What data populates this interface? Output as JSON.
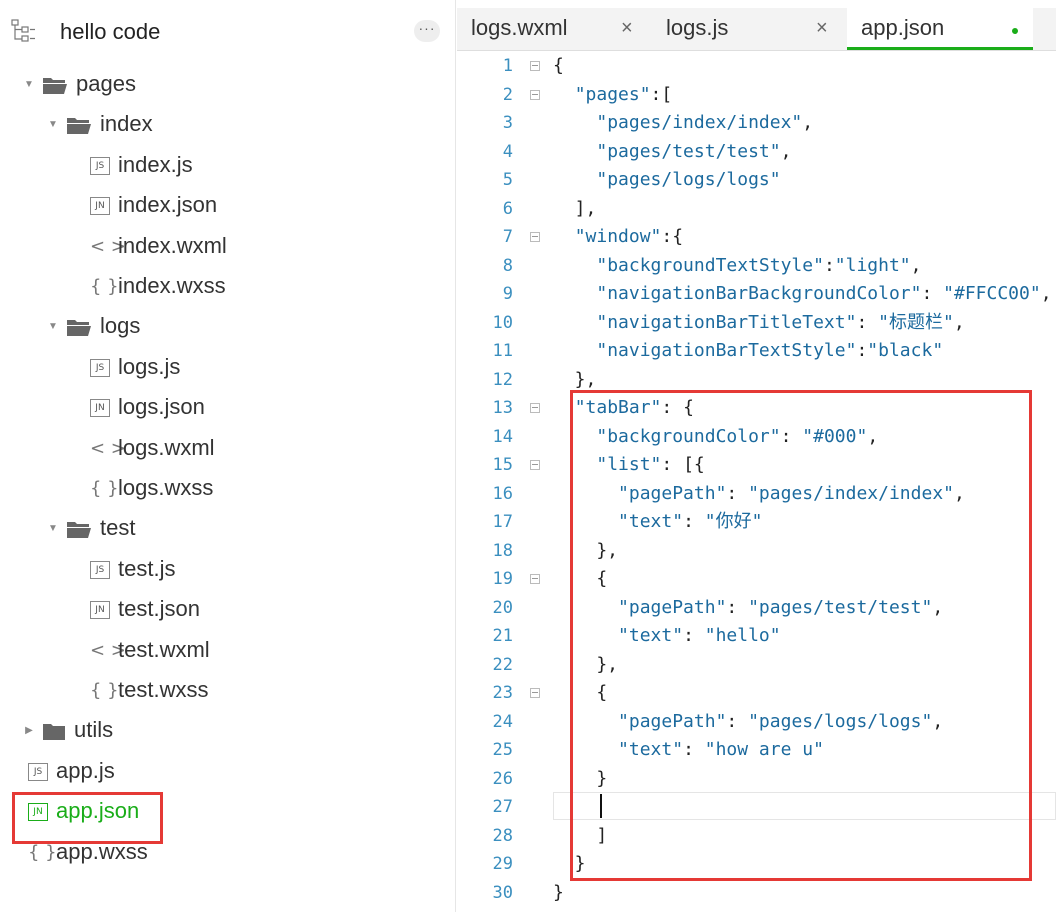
{
  "sidebar": {
    "title": "hello code",
    "more": "···",
    "tree": [
      {
        "label": "pages",
        "type": "folder",
        "expanded": true
      },
      {
        "label": "index",
        "type": "folder",
        "expanded": true
      },
      {
        "label": "index.js",
        "type": "js",
        "badge": "JS"
      },
      {
        "label": "index.json",
        "type": "json",
        "badge": "JN"
      },
      {
        "label": "index.wxml",
        "type": "wxml",
        "badge": "< >"
      },
      {
        "label": "index.wxss",
        "type": "wxss",
        "badge": "{ }"
      },
      {
        "label": "logs",
        "type": "folder",
        "expanded": true
      },
      {
        "label": "logs.js",
        "type": "js",
        "badge": "JS"
      },
      {
        "label": "logs.json",
        "type": "json",
        "badge": "JN"
      },
      {
        "label": "logs.wxml",
        "type": "wxml",
        "badge": "< >"
      },
      {
        "label": "logs.wxss",
        "type": "wxss",
        "badge": "{ }"
      },
      {
        "label": "test",
        "type": "folder",
        "expanded": true
      },
      {
        "label": "test.js",
        "type": "js",
        "badge": "JS"
      },
      {
        "label": "test.json",
        "type": "json",
        "badge": "JN"
      },
      {
        "label": "test.wxml",
        "type": "wxml",
        "badge": "< >"
      },
      {
        "label": "test.wxss",
        "type": "wxss",
        "badge": "{ }"
      },
      {
        "label": "utils",
        "type": "folder",
        "expanded": false
      },
      {
        "label": "app.js",
        "type": "js",
        "badge": "JS"
      },
      {
        "label": "app.json",
        "type": "json",
        "badge": "JN",
        "selected": true
      },
      {
        "label": "app.wxss",
        "type": "wxss",
        "badge": "{ }"
      }
    ]
  },
  "tabs": [
    {
      "label": "logs.wxml",
      "close": "×"
    },
    {
      "label": "logs.js",
      "close": "×"
    },
    {
      "label": "app.json",
      "active": true,
      "modified": true
    }
  ],
  "editor": {
    "lines": [
      "{",
      "  \"pages\":[",
      "    \"pages/index/index\",",
      "    \"pages/test/test\",",
      "    \"pages/logs/logs\"",
      "  ],",
      "  \"window\":{",
      "    \"backgroundTextStyle\":\"light\",",
      "    \"navigationBarBackgroundColor\": \"#FFCC00\",",
      "    \"navigationBarTitleText\": \"标题栏\",",
      "    \"navigationBarTextStyle\":\"black\"",
      "  },",
      "  \"tabBar\": {",
      "    \"backgroundColor\": \"#000\",",
      "    \"list\": [{",
      "      \"pagePath\": \"pages/index/index\",",
      "      \"text\": \"你好\"",
      "    },",
      "    {",
      "      \"pagePath\": \"pages/test/test\",",
      "      \"text\": \"hello\"",
      "    },",
      "    {",
      "      \"pagePath\": \"pages/logs/logs\",",
      "      \"text\": \"how are u\"",
      "    }",
      "    ",
      "    ]",
      "  }",
      "}"
    ],
    "fold_lines": [
      1,
      2,
      7,
      13,
      15,
      19,
      23
    ],
    "cursor_line": 27
  },
  "colors": {
    "accent": "#1aad19",
    "highlight": "#e53935",
    "line_number": "#3b8fbf",
    "string": "#1c6a9e"
  }
}
